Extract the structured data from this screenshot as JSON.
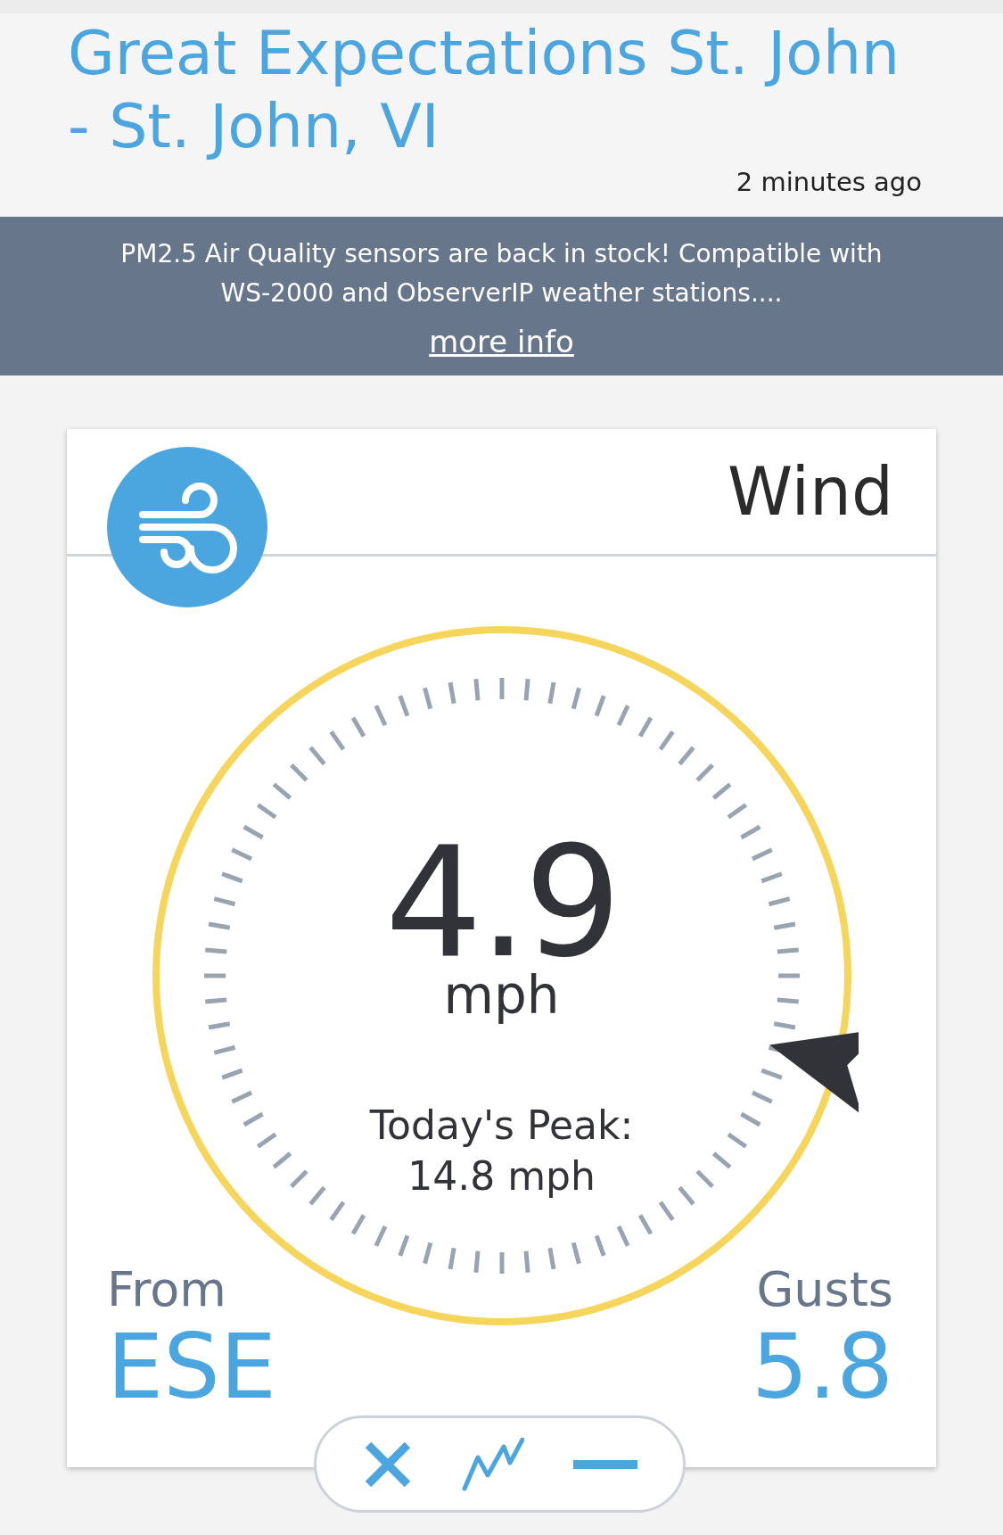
{
  "header": {
    "title": "Great Expectations St. John - St. John, VI",
    "updated": "2 minutes ago"
  },
  "banner": {
    "message": "PM2.5 Air Quality sensors are back in stock! Compatible with WS-2000 and ObserverIP weather stations....",
    "link": "more info"
  },
  "card": {
    "title": "Wind",
    "speed": "4.9",
    "unit": "mph",
    "peak_label": "Today's Peak:",
    "peak_value": "14.8 mph",
    "direction_label": "From",
    "direction": "ESE",
    "gusts_label": "Gusts",
    "gusts": "5.8"
  },
  "toolbar": [
    {
      "kind": "close"
    },
    {
      "kind": "chart"
    },
    {
      "kind": "minimize"
    }
  ]
}
